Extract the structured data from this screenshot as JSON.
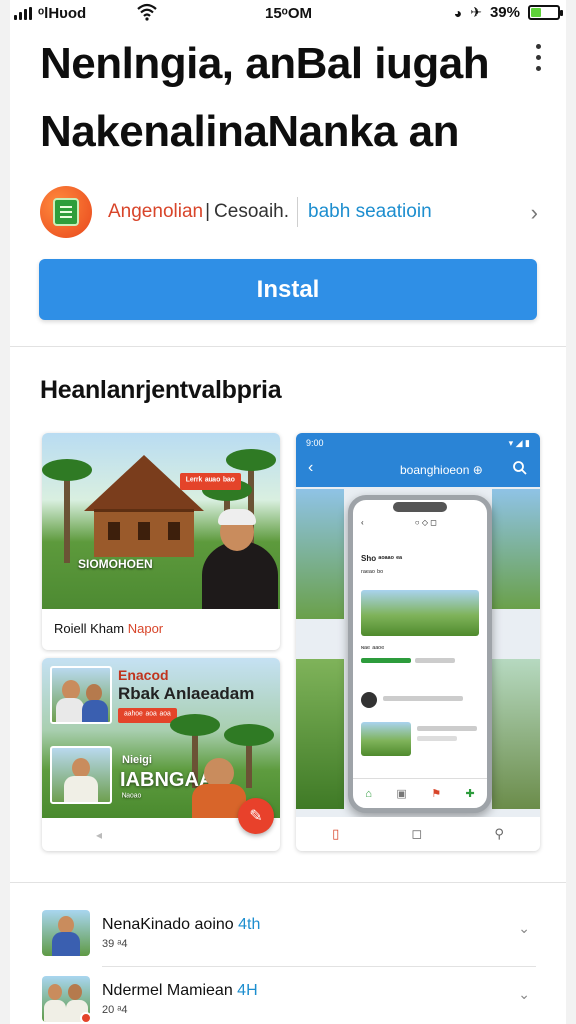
{
  "status_bar": {
    "carrier": "ᵒlHᴜod",
    "time": "15ᵒOM",
    "battery_text": "39%",
    "battery_level": 0.39
  },
  "app": {
    "title_line1": "Nenlngia, anBal iugah",
    "title_line2": "NakenalinaNanka an",
    "developer": "Angenolian",
    "category": "Cesoaih.",
    "tag": "babh seaatioin",
    "install_label": "Instal"
  },
  "screenshots": {
    "section_title": "Heanlanrjentvalbpria",
    "shot1": {
      "badge": "ᴸᵉʳʳᵏ ᵃᵘᵃᵒ ᵇᵃᵒ",
      "overlay": "SIOMOHOEN",
      "caption_main": "Roiell Kham",
      "caption_accent": "Napor"
    },
    "shot2": {
      "appbar_title": "boanghioeon ⊕",
      "status_left": "9:00",
      "status_right": "▾ ◢ ▮",
      "row1": "Sho ᵃᵒᵃᵃᵒ ᵉᵃ",
      "row2": "ʳᵃᵉᵃᵒ ᵇᵒ",
      "row3": "ᶰᵃᵉ ᵃᵃᵒᵉ"
    },
    "shot3": {
      "kicker": "Enacod",
      "title": "Rbak Anlaeadam",
      "badge": "ᵃᵃʰᵒᵉ ᵃᵒᵃ ᵃᵒᵃ",
      "small": "Nieigi",
      "big": "IABNGAA",
      "small2": "ᴺᵃᵒᵃᵒ"
    }
  },
  "list": [
    {
      "title": "NenaKinado aoino",
      "accent": "4th",
      "sub": "39 ᵃ4"
    },
    {
      "title": "Ndermel Mamiean",
      "accent": "4H",
      "sub": "20 ᵃ4"
    }
  ]
}
